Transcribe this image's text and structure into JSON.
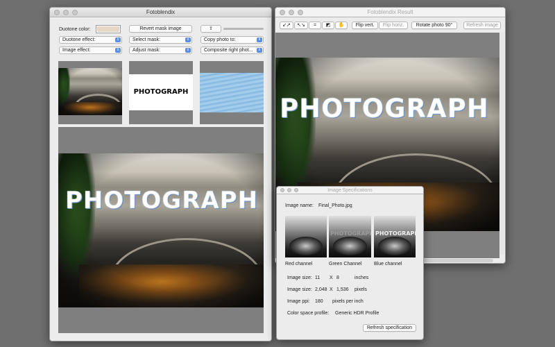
{
  "main_window": {
    "title": "Fotoblendix",
    "duotone_color_label": "Duotone color:",
    "duotone_swatch_color": "#e7d7c8",
    "revert_mask_button": "Revert mask image",
    "duotone_effect_select": "Duotone effect:",
    "select_mask_select": "Select mask:",
    "copy_photo_select": "Copy photo to:",
    "image_effect_select": "Image effect:",
    "adjust_mask_select": "Adjust mask:",
    "composite_select": "Composite right phot...",
    "mask_word": "PHOTOGRAPH",
    "composite_word": "PHOTOGRAPH"
  },
  "result_window": {
    "title": "Fotoblendix Result",
    "tools": {
      "shrink_icon": "↙↗",
      "expand_icon": "↖↘",
      "equal_icon": "=",
      "contrast_icon": "◩",
      "hand_icon": "✋"
    },
    "flip_vert_button": "Flip vert.",
    "flip_horiz_button": "Flip horiz.",
    "rotate_button": "Rotate photo 90°",
    "refresh_image_button": "Refresh image",
    "composite_word": "PHOTOGRAPH"
  },
  "spec_window": {
    "title": "Image Specifications",
    "image_name_label": "Image name:",
    "image_name_value": "Final_Photo.jpg",
    "channels": [
      {
        "label": "Red channel",
        "word": ""
      },
      {
        "label": "Green Channel",
        "word": "PHOTOGRAPH"
      },
      {
        "label": "Blue channel",
        "word": "PHOTOGRAPH"
      }
    ],
    "size_in_label": "Image size:",
    "size_in_w": "11",
    "size_in_x": "X",
    "size_in_h": "8",
    "size_in_unit": "inches",
    "size_px_label": "Image size:",
    "size_px_w": "2,048",
    "size_px_x": "X",
    "size_px_h": "1,536",
    "size_px_unit": "pixels",
    "ppi_label": "Image ppi:",
    "ppi_value": "180",
    "ppi_unit": "pixels per inch",
    "profile_label": "Color space profile:",
    "profile_value": "Generic HDR Profile",
    "refresh_spec_button": "Refresh specification"
  }
}
